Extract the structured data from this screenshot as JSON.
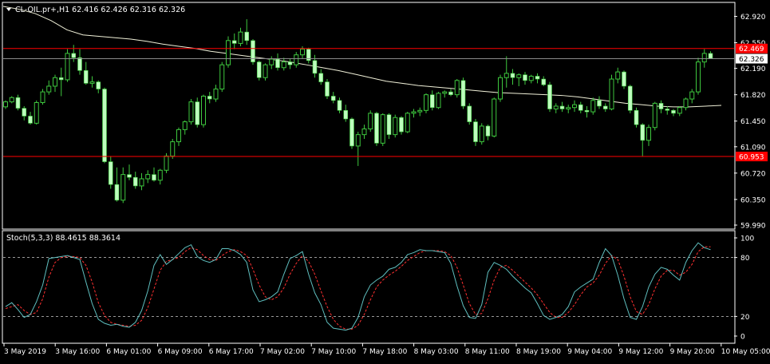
{
  "header": {
    "symbol_line": "CL-OIL.pr+,H1  62.416 62.426 62.316 62.326",
    "stoch_line": "Stoch(5,3,3) 88.4615 88.3614"
  },
  "colors": {
    "background": "#000000",
    "bull_candle": "#bdffbd",
    "bear_candle": "#bdffbd",
    "wick": "#3ec83e",
    "ma": "#f0f0d8",
    "hline": "#ff0000",
    "price_tag": "#ff0000",
    "stoch_main": "#5fbfbf",
    "stoch_signal": "#ff3030",
    "grid": "#ffffff",
    "axis_text": "#ffffff"
  },
  "chart_data": [
    {
      "type": "candlestick",
      "title": "CL-OIL.pr+,H1",
      "ylim": [
        59.99,
        63.06
      ],
      "y_ticks": [
        "62.920",
        "62.550",
        "62.190",
        "61.820",
        "61.450",
        "61.090",
        "60.720",
        "60.350",
        "59.990"
      ],
      "x_ticks": [
        "3 May 2019",
        "3 May 16:00",
        "6 May 01:00",
        "6 May 09:00",
        "6 May 17:00",
        "7 May 02:00",
        "7 May 10:00",
        "7 May 18:00",
        "8 May 03:00",
        "8 May 11:00",
        "8 May 19:00",
        "9 May 04:00",
        "9 May 12:00",
        "9 May 20:00",
        "10 May 05:00"
      ],
      "hlines": [
        {
          "value": 62.469,
          "label": "62.469"
        },
        {
          "value": 60.953,
          "label": "60.953"
        }
      ],
      "current_price": {
        "value": 62.326,
        "label": "62.326"
      },
      "candles": [
        [
          61.65,
          61.74,
          61.62,
          61.72
        ],
        [
          61.72,
          61.8,
          61.7,
          61.78
        ],
        [
          61.78,
          61.82,
          61.6,
          61.63
        ],
        [
          61.63,
          61.66,
          61.46,
          61.52
        ],
        [
          61.52,
          61.58,
          61.4,
          61.42
        ],
        [
          61.42,
          61.74,
          61.4,
          61.71
        ],
        [
          61.71,
          61.9,
          61.68,
          61.86
        ],
        [
          61.86,
          62.02,
          61.82,
          61.94
        ],
        [
          61.94,
          62.1,
          61.86,
          62.06
        ],
        [
          62.06,
          62.2,
          61.8,
          62.03
        ],
        [
          62.03,
          62.46,
          62.0,
          62.4
        ],
        [
          62.4,
          62.52,
          62.28,
          62.34
        ],
        [
          62.34,
          62.46,
          62.1,
          62.16
        ],
        [
          62.16,
          62.28,
          61.96,
          61.98
        ],
        [
          61.98,
          62.08,
          61.92,
          62.0
        ],
        [
          62.0,
          62.02,
          61.84,
          61.9
        ],
        [
          61.9,
          61.92,
          60.86,
          60.88
        ],
        [
          60.88,
          60.96,
          60.5,
          60.56
        ],
        [
          60.56,
          60.8,
          60.32,
          60.34
        ],
        [
          60.34,
          60.8,
          60.3,
          60.7
        ],
        [
          60.7,
          60.84,
          60.62,
          60.66
        ],
        [
          60.66,
          60.74,
          60.5,
          60.54
        ],
        [
          60.54,
          60.72,
          60.48,
          60.64
        ],
        [
          60.64,
          60.76,
          60.58,
          60.7
        ],
        [
          60.7,
          60.8,
          60.6,
          60.62
        ],
        [
          60.62,
          60.78,
          60.56,
          60.76
        ],
        [
          60.76,
          61.0,
          60.72,
          60.96
        ],
        [
          60.96,
          61.2,
          60.92,
          61.16
        ],
        [
          61.16,
          61.36,
          61.1,
          61.33
        ],
        [
          61.33,
          61.46,
          61.26,
          61.44
        ],
        [
          61.44,
          61.76,
          61.4,
          61.72
        ],
        [
          61.72,
          61.78,
          61.36,
          61.4
        ],
        [
          61.4,
          61.82,
          61.36,
          61.8
        ],
        [
          61.8,
          61.86,
          61.7,
          61.76
        ],
        [
          61.76,
          61.96,
          61.72,
          61.9
        ],
        [
          61.9,
          62.28,
          61.86,
          62.24
        ],
        [
          62.24,
          62.64,
          62.2,
          62.58
        ],
        [
          62.58,
          62.68,
          62.46,
          62.54
        ],
        [
          62.54,
          62.76,
          62.5,
          62.7
        ],
        [
          62.7,
          62.88,
          62.52,
          62.58
        ],
        [
          62.58,
          62.6,
          62.24,
          62.28
        ],
        [
          62.28,
          62.3,
          62.02,
          62.06
        ],
        [
          62.06,
          62.26,
          62.02,
          62.24
        ],
        [
          62.24,
          62.36,
          62.18,
          62.32
        ],
        [
          62.32,
          62.4,
          62.16,
          62.2
        ],
        [
          62.2,
          62.34,
          62.16,
          62.28
        ],
        [
          62.28,
          62.32,
          62.18,
          62.24
        ],
        [
          62.24,
          62.42,
          62.2,
          62.38
        ],
        [
          62.38,
          62.5,
          62.32,
          62.46
        ],
        [
          62.46,
          62.48,
          62.26,
          62.3
        ],
        [
          62.3,
          62.38,
          62.06,
          62.12
        ],
        [
          62.12,
          62.18,
          61.96,
          62.0
        ],
        [
          62.0,
          62.04,
          61.76,
          61.8
        ],
        [
          61.8,
          61.86,
          61.7,
          61.74
        ],
        [
          61.74,
          61.78,
          61.56,
          61.6
        ],
        [
          61.6,
          61.68,
          61.44,
          61.48
        ],
        [
          61.48,
          61.5,
          61.06,
          61.1
        ],
        [
          61.1,
          61.3,
          60.82,
          61.26
        ],
        [
          61.26,
          61.4,
          61.2,
          61.34
        ],
        [
          61.34,
          61.6,
          61.3,
          61.56
        ],
        [
          61.56,
          61.58,
          61.1,
          61.14
        ],
        [
          61.14,
          61.56,
          61.1,
          61.54
        ],
        [
          61.54,
          61.56,
          61.2,
          61.26
        ],
        [
          61.26,
          61.54,
          61.22,
          61.5
        ],
        [
          61.5,
          61.52,
          61.26,
          61.3
        ],
        [
          61.3,
          61.58,
          61.28,
          61.56
        ],
        [
          61.56,
          61.62,
          61.5,
          61.58
        ],
        [
          61.58,
          61.64,
          61.52,
          61.6
        ],
        [
          61.6,
          61.84,
          61.56,
          61.82
        ],
        [
          61.82,
          61.88,
          61.6,
          61.64
        ],
        [
          61.64,
          61.86,
          61.62,
          61.84
        ],
        [
          61.84,
          61.88,
          61.78,
          61.86
        ],
        [
          61.86,
          61.9,
          61.8,
          61.82
        ],
        [
          61.82,
          62.04,
          61.78,
          62.02
        ],
        [
          62.02,
          62.06,
          61.62,
          61.66
        ],
        [
          61.66,
          61.7,
          61.4,
          61.44
        ],
        [
          61.44,
          61.48,
          61.1,
          61.16
        ],
        [
          61.16,
          61.42,
          61.12,
          61.38
        ],
        [
          61.38,
          61.4,
          61.18,
          61.24
        ],
        [
          61.24,
          61.78,
          61.22,
          61.76
        ],
        [
          61.76,
          62.1,
          61.72,
          62.06
        ],
        [
          62.06,
          62.36,
          61.92,
          62.12
        ],
        [
          62.12,
          62.18,
          61.96,
          62.06
        ],
        [
          62.06,
          62.12,
          61.94,
          62.1
        ],
        [
          62.1,
          62.14,
          61.96,
          62.02
        ],
        [
          62.02,
          62.1,
          61.98,
          62.08
        ],
        [
          62.08,
          62.12,
          61.98,
          62.04
        ],
        [
          62.04,
          62.08,
          61.94,
          61.96
        ],
        [
          61.96,
          62.0,
          61.58,
          61.62
        ],
        [
          61.62,
          61.7,
          61.56,
          61.66
        ],
        [
          61.66,
          61.72,
          61.58,
          61.62
        ],
        [
          61.62,
          61.68,
          61.56,
          61.64
        ],
        [
          61.64,
          61.74,
          61.58,
          61.68
        ],
        [
          61.68,
          61.72,
          61.56,
          61.6
        ],
        [
          61.6,
          61.66,
          61.5,
          61.58
        ],
        [
          61.58,
          61.78,
          61.54,
          61.74
        ],
        [
          61.74,
          61.8,
          61.62,
          61.66
        ],
        [
          61.66,
          61.7,
          61.58,
          61.62
        ],
        [
          61.62,
          62.1,
          61.6,
          62.04
        ],
        [
          62.04,
          62.2,
          61.98,
          62.14
        ],
        [
          62.14,
          62.16,
          61.9,
          61.94
        ],
        [
          61.94,
          61.96,
          61.56,
          61.6
        ],
        [
          61.6,
          61.64,
          61.36,
          61.4
        ],
        [
          61.4,
          61.42,
          60.96,
          61.18
        ],
        [
          61.18,
          61.4,
          61.1,
          61.36
        ],
        [
          61.36,
          61.72,
          61.32,
          61.7
        ],
        [
          61.7,
          61.74,
          61.56,
          61.62
        ],
        [
          61.62,
          61.66,
          61.54,
          61.6
        ],
        [
          61.6,
          61.62,
          61.52,
          61.56
        ],
        [
          61.56,
          61.66,
          61.52,
          61.64
        ],
        [
          61.64,
          61.78,
          61.6,
          61.76
        ],
        [
          61.76,
          61.9,
          61.7,
          61.86
        ],
        [
          61.86,
          62.34,
          61.82,
          62.28
        ],
        [
          62.28,
          62.46,
          62.2,
          62.4
        ],
        [
          62.4,
          62.43,
          62.32,
          62.33
        ]
      ],
      "ma": [
        [
          0,
          63.06
        ],
        [
          20,
          63.02
        ],
        [
          40,
          62.96
        ],
        [
          60,
          62.86
        ],
        [
          80,
          62.73
        ],
        [
          100,
          62.66
        ],
        [
          120,
          62.64
        ],
        [
          140,
          62.62
        ],
        [
          160,
          62.6
        ],
        [
          180,
          62.57
        ],
        [
          200,
          62.53
        ],
        [
          220,
          62.5
        ],
        [
          240,
          62.47
        ],
        [
          260,
          62.43
        ],
        [
          280,
          62.4
        ],
        [
          300,
          62.37
        ],
        [
          320,
          62.34
        ],
        [
          340,
          62.31
        ],
        [
          360,
          62.28
        ],
        [
          380,
          62.24
        ],
        [
          400,
          62.2
        ],
        [
          420,
          62.16
        ],
        [
          440,
          62.11
        ],
        [
          460,
          62.06
        ],
        [
          480,
          62.01
        ],
        [
          500,
          61.98
        ],
        [
          520,
          61.95
        ],
        [
          540,
          61.93
        ],
        [
          560,
          61.91
        ],
        [
          580,
          61.89
        ],
        [
          600,
          61.87
        ],
        [
          620,
          61.85
        ],
        [
          640,
          61.84
        ],
        [
          660,
          61.83
        ],
        [
          680,
          61.82
        ],
        [
          700,
          61.81
        ],
        [
          720,
          61.79
        ],
        [
          740,
          61.76
        ],
        [
          760,
          61.73
        ],
        [
          780,
          61.7
        ],
        [
          800,
          61.68
        ],
        [
          820,
          61.66
        ],
        [
          840,
          61.65
        ],
        [
          860,
          61.65
        ],
        [
          880,
          61.66
        ],
        [
          900,
          61.67
        ]
      ]
    },
    {
      "type": "line",
      "title": "Stoch(5,3,3)",
      "ylim": [
        0,
        100
      ],
      "y_ticks": [
        "100",
        "80",
        "20",
        "0"
      ],
      "levels": [
        80,
        20
      ],
      "series": [
        {
          "name": "main",
          "values": [
            30,
            34,
            27,
            19,
            22,
            35,
            52,
            79,
            80,
            81,
            82,
            80,
            78,
            55,
            33,
            17,
            13,
            11,
            12,
            10,
            9,
            14,
            26,
            46,
            72,
            83,
            73,
            78,
            84,
            90,
            93,
            81,
            77,
            75,
            78,
            89,
            89,
            87,
            83,
            75,
            47,
            35,
            37,
            40,
            45,
            63,
            79,
            82,
            86,
            63,
            44,
            32,
            14,
            8,
            7,
            6,
            8,
            19,
            40,
            52,
            57,
            61,
            68,
            70,
            75,
            83,
            85,
            88,
            87,
            87,
            86,
            85,
            74,
            51,
            31,
            19,
            18,
            32,
            65,
            75,
            72,
            68,
            61,
            55,
            49,
            44,
            33,
            21,
            17,
            19,
            22,
            30,
            45,
            50,
            54,
            58,
            75,
            89,
            82,
            62,
            38,
            19,
            17,
            30,
            50,
            63,
            70,
            68,
            62,
            57,
            75,
            87,
            95,
            90,
            88
          ]
        },
        {
          "name": "signal",
          "values": [
            28,
            30,
            32,
            26,
            22,
            24,
            38,
            60,
            75,
            80,
            81,
            81,
            80,
            72,
            55,
            34,
            21,
            14,
            12,
            11,
            10,
            11,
            16,
            29,
            48,
            67,
            76,
            78,
            80,
            86,
            90,
            88,
            82,
            78,
            77,
            82,
            86,
            88,
            86,
            82,
            68,
            52,
            40,
            37,
            40,
            49,
            63,
            74,
            82,
            76,
            63,
            46,
            30,
            17,
            10,
            7,
            7,
            11,
            22,
            37,
            50,
            57,
            62,
            66,
            71,
            77,
            81,
            85,
            87,
            87,
            87,
            86,
            82,
            70,
            52,
            33,
            22,
            23,
            38,
            57,
            70,
            72,
            67,
            61,
            55,
            49,
            42,
            33,
            24,
            19,
            19,
            24,
            32,
            42,
            50,
            54,
            62,
            74,
            82,
            78,
            61,
            40,
            25,
            22,
            32,
            48,
            61,
            67,
            67,
            62,
            65,
            73,
            86,
            91,
            91
          ]
        }
      ]
    }
  ]
}
